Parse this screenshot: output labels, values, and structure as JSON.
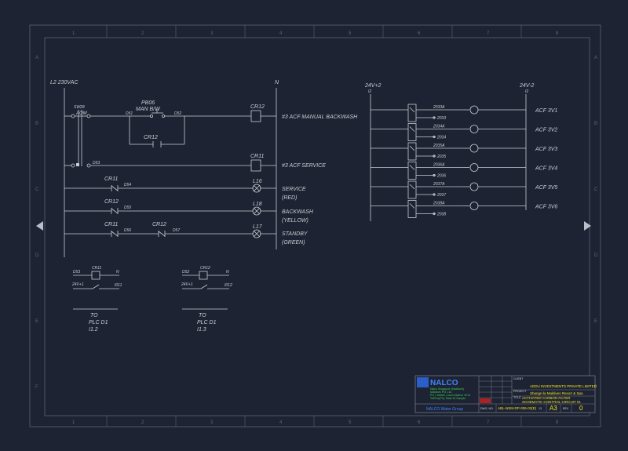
{
  "frame": {
    "top_zones": [
      "1",
      "2",
      "3",
      "4",
      "5",
      "6",
      "7",
      "8"
    ],
    "side_zones": [
      "A",
      "B",
      "C",
      "D",
      "E",
      "F"
    ]
  },
  "rails": {
    "left": "L2 230VAC",
    "right": "N"
  },
  "selector": {
    "tag": "SW28",
    "label": "AOM"
  },
  "pushbutton": {
    "tag": "PB06",
    "label": "MAN B/W"
  },
  "wires": {
    "d51": "D51",
    "d52": "D52",
    "d53": "D53",
    "d54": "D54",
    "d55": "D55",
    "d56": "D56",
    "d57": "D57"
  },
  "rungs": [
    {
      "contacts": [
        "CR12"
      ],
      "device": "CR12",
      "desc": "#3 ACF MANUAL BACKWASH"
    },
    {
      "contacts": [],
      "device": "CR11",
      "desc": "#3 ACF SERVICE"
    },
    {
      "contacts": [
        "CR11"
      ],
      "device": "L16",
      "desc": "SERVICE",
      "color": "(RED)"
    },
    {
      "contacts": [
        "CR12"
      ],
      "device": "L18",
      "desc": "BACKWASH",
      "color": "(YELLOW)"
    },
    {
      "contacts": [
        "CR11",
        "CR12"
      ],
      "device": "L17",
      "desc": "STANDBY",
      "color": "(GREEN)"
    }
  ],
  "plc_circuits": [
    {
      "wire": "D53",
      "coil": "CR11",
      "n": "N",
      "supply": "24V+1",
      "output": "I011",
      "to": "TO",
      "plc": "PLC D1",
      "addr": "I1.2"
    },
    {
      "wire": "D52",
      "coil": "CR12",
      "n": "N",
      "supply": "24V+1",
      "output": "I012",
      "to": "TO",
      "plc": "PLC D1",
      "addr": "I1.3"
    }
  ],
  "dc_bus": {
    "left": "24V+2",
    "right": "24V-2",
    "left_ref": "I2",
    "right_ref": "I2"
  },
  "dc_outputs": [
    {
      "wire_a": "2033A",
      "wire_b": "2033",
      "label": "ACF 3V1"
    },
    {
      "wire_a": "2034A",
      "wire_b": "2034",
      "label": "ACF 3V2"
    },
    {
      "wire_a": "2035A",
      "wire_b": "2035",
      "label": "ACF 3V3"
    },
    {
      "wire_a": "2036A",
      "wire_b": "2036",
      "label": "ACF 3V4"
    },
    {
      "wire_a": "2037A",
      "wire_b": "2037",
      "label": "ACF 3V5"
    },
    {
      "wire_a": "2038A",
      "wire_b": "2038",
      "label": "ACF 3V6"
    }
  ],
  "title_block": {
    "logo": "NALCO",
    "company_lines": [
      "Nalco Singapore (Maldives)",
      "Maldives Pvt. Ltd.",
      "PO 1 #####, Lorem Marine 2013",
      "Tel/Fax(Ph), Male 20 Sample"
    ],
    "group": "NALCO Water Group",
    "client_label": "CLIENT",
    "client": "ADDU INVESTMENTS PRIVATE LIMITED",
    "project_label": "PROJECT",
    "project": "Shangri-la Maldives Resort & Spa",
    "title_label": "TITLE",
    "title_1": "ACTIVATED CARBON FILTER",
    "title_2": "SCHEMATIC CONTROL CIRCUIT 01",
    "dwg_label": "DWG. NO.",
    "dwg_no": "ABL-NSM-DP-006-03(E)",
    "sheet": "13",
    "size_label": "",
    "size": "A3",
    "rev_label": "REV",
    "rev": "0"
  }
}
